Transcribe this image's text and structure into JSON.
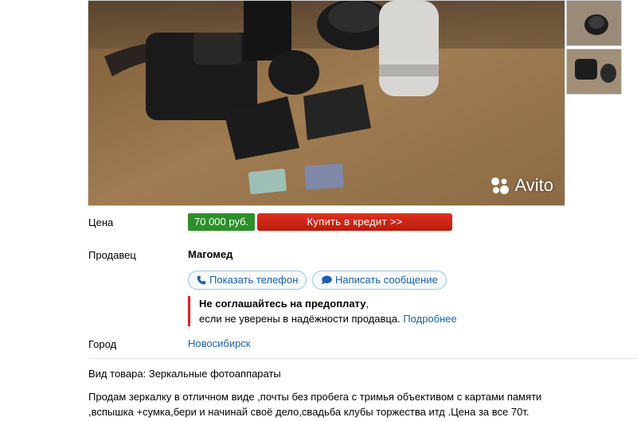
{
  "watermark": "Avito",
  "price": {
    "label": "Цена",
    "value": "70 000 руб.",
    "credit_button": "Купить в кредит >>"
  },
  "seller": {
    "label": "Продавец",
    "name": "Магомед",
    "show_phone": "Показать телефон",
    "write_message": "Написать сообщение"
  },
  "warning": {
    "title": "Не соглашайтесь на предоплату",
    "title_suffix": ",",
    "text": "если не уверены в надёжности продавца.",
    "link": "Подробнее"
  },
  "city": {
    "label": "Город",
    "value": "Новосибирск"
  },
  "category": "Вид товара: Зеркальные фотоаппараты",
  "description": "Продам зеркалку в отличном виде ,почты без пробега с тримья объективом с картами памяти ,вспышка +сумка,бери и начинай своё дело,свадьба клубы торжества итд .Цена за все 70т.",
  "colors": {
    "price_green": "#2c8f27",
    "credit_red": "#d0261a",
    "link_blue": "#1a5fa8",
    "warning_red": "#dd2222"
  }
}
